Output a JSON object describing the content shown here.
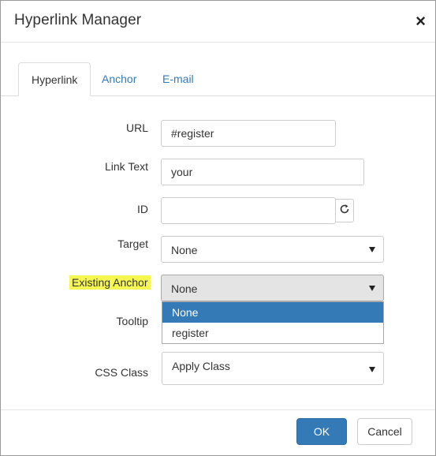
{
  "dialog": {
    "title": "Hyperlink Manager",
    "close_icon": "×"
  },
  "tabs": [
    {
      "label": "Hyperlink",
      "active": true
    },
    {
      "label": "Anchor",
      "active": false
    },
    {
      "label": "E-mail",
      "active": false
    }
  ],
  "form": {
    "url": {
      "label": "URL",
      "value": "#register"
    },
    "link_text": {
      "label": "Link Text",
      "value": "your"
    },
    "id": {
      "label": "ID",
      "value": "",
      "refresh_icon": "refresh-icon"
    },
    "target": {
      "label": "Target",
      "value": "None"
    },
    "existing_anchor": {
      "label": "Existing Anchor",
      "value": "None",
      "highlight_color": "#f7f751",
      "options": [
        "None",
        "register"
      ],
      "selected_option": "None"
    },
    "tooltip": {
      "label": "Tooltip",
      "value": ""
    },
    "css_class": {
      "label": "CSS Class",
      "value": "Apply Class"
    }
  },
  "footer": {
    "ok_label": "OK",
    "cancel_label": "Cancel"
  },
  "colors": {
    "accent": "#337ab7",
    "link": "#337ab7"
  }
}
